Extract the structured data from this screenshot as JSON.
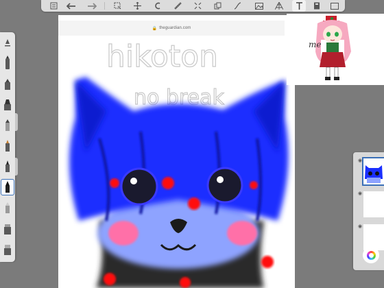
{
  "toolbar": {
    "icons": [
      "layers-list-icon",
      "undo-icon",
      "redo-icon",
      "select-icon",
      "transform-icon",
      "symmetry-icon",
      "ruler-icon",
      "distort-icon",
      "copy-icon",
      "curve-icon",
      "import-image-icon",
      "perspective-icon",
      "text-icon",
      "time-lapse-icon",
      "fullscreen-icon"
    ],
    "active_tool": "text-icon"
  },
  "side_tools": {
    "tools": [
      "brush-size-icon",
      "marker-icon",
      "airbrush-icon",
      "paintbrush-icon",
      "pencil-icon",
      "ballpoint-pen-icon",
      "ink-pen-icon",
      "calligraphy-pen-icon",
      "eraser-icon",
      "fill-icon",
      "blender-icon"
    ],
    "active_index": 7
  },
  "canvas": {
    "url_text": "theguardian.com",
    "handwriting_line1": "hikoton",
    "handwriting_line2": "no break"
  },
  "reference": {
    "label": "me"
  },
  "layers": {
    "count": 3,
    "selected_index": 0
  },
  "colors": {
    "background": "#7b7b7b",
    "accent": "#3a6fb7",
    "fur_blue": "#1a2fff",
    "blush": "#ff6fa8",
    "spot_red": "#ff1010"
  }
}
